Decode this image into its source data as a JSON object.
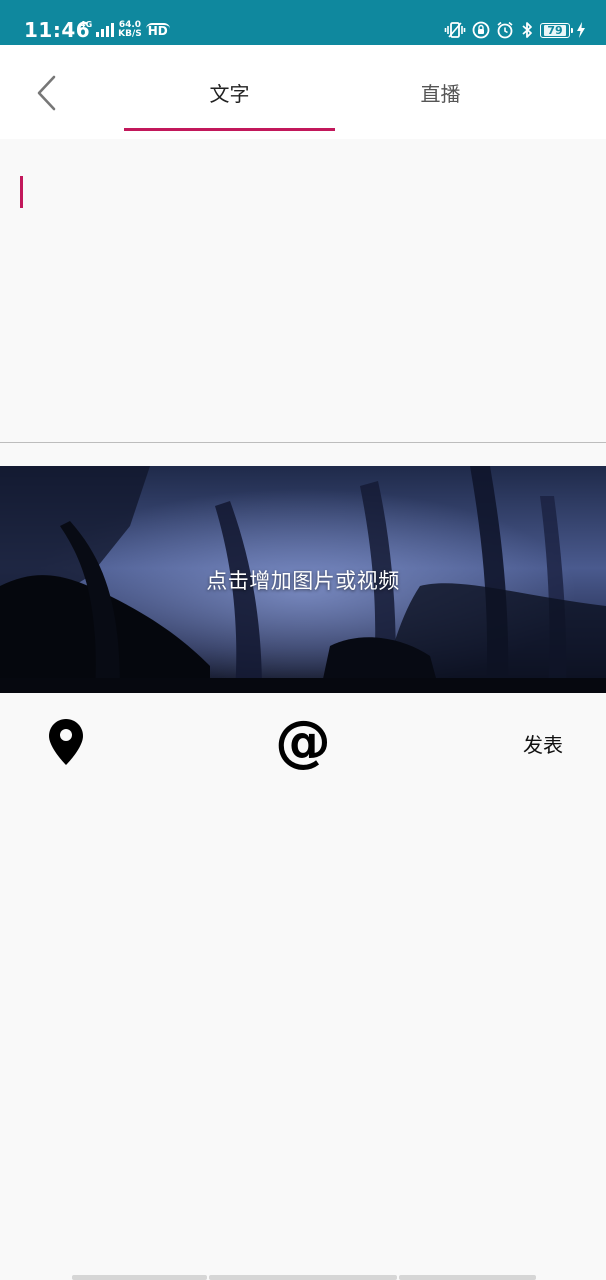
{
  "status_bar": {
    "time": "11:46",
    "network_type": "4G",
    "speed_value": "64.0",
    "speed_unit": "KB/S",
    "hd_label": "HD",
    "battery_level": "79",
    "icons": [
      "signal-icon",
      "vibrate-icon",
      "rotation-lock-icon",
      "alarm-icon",
      "bluetooth-icon",
      "battery-icon",
      "charging-icon"
    ]
  },
  "header": {
    "back_icon": "chevron-left-icon",
    "tabs": [
      {
        "label": "文字",
        "selected": true
      },
      {
        "label": "直播",
        "selected": false
      }
    ]
  },
  "editor": {
    "value": "",
    "placeholder": ""
  },
  "media_picker": {
    "label": "点击增加图片或视频"
  },
  "actions": {
    "location_icon": "location-pin-icon",
    "mention_label": "@",
    "publish_label": "发表"
  },
  "colors": {
    "status_bar": "#0f889e",
    "accent": "#c2185b",
    "background": "#f9f9f9",
    "header_bg": "#ffffff"
  }
}
